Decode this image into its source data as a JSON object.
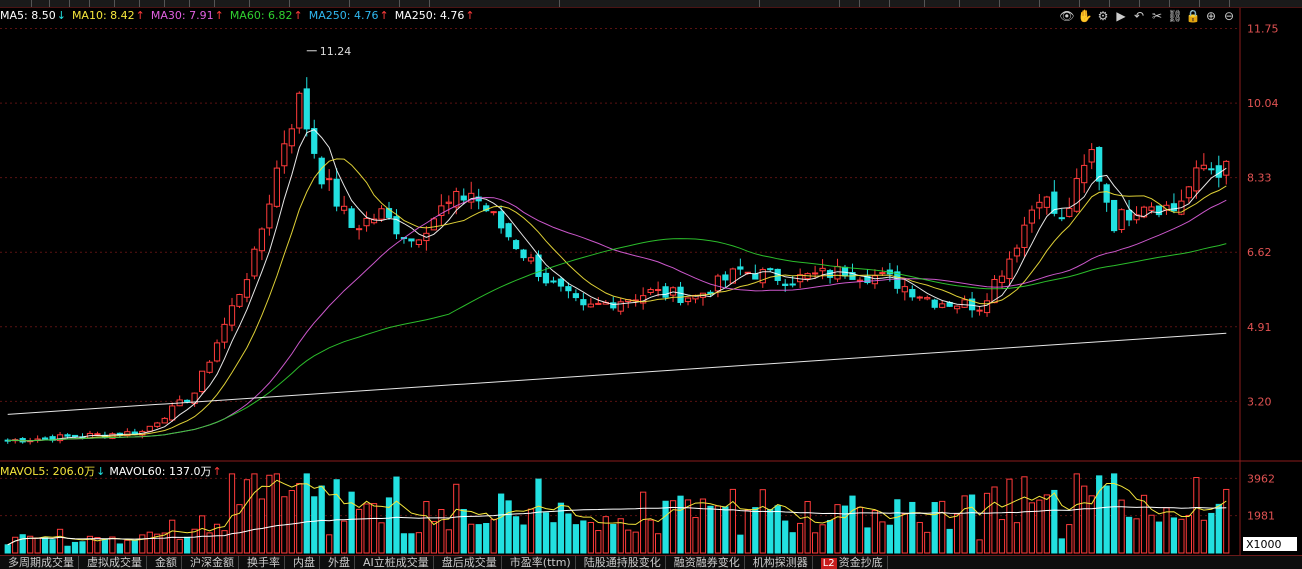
{
  "ma_legend": [
    {
      "label": "MA5: 8.50",
      "trend": "down",
      "color": "#ffffff"
    },
    {
      "label": "MA10: 8.42",
      "trend": "up",
      "color": "#f5e63c"
    },
    {
      "label": "MA30: 7.91",
      "trend": "up",
      "color": "#e060e0"
    },
    {
      "label": "MA60: 6.82",
      "trend": "up",
      "color": "#30d030"
    },
    {
      "label": "MA250: 4.76",
      "trend": "up",
      "color": "#30b8f0"
    },
    {
      "label": "MA250: 4.76",
      "trend": "up",
      "color": "#ffffff"
    }
  ],
  "vol_legend": [
    {
      "label": "MAVOL5: 206.0万",
      "trend": "down",
      "color": "#f5e63c"
    },
    {
      "label": "MAVOL60: 137.0万",
      "trend": "up",
      "color": "#ffffff"
    }
  ],
  "toolbar_icons": [
    "eye-icon",
    "hand-icon",
    "settings-icon",
    "play-icon",
    "undo-icon",
    "scissors-icon",
    "link-icon",
    "lock-icon",
    "zoom-in-icon",
    "zoom-out-icon"
  ],
  "toolbar_glyphs": [
    "👁",
    "✋",
    "⚙",
    "▶",
    "↶",
    "✂",
    "⛓",
    "🔒",
    "⊕",
    "⊖"
  ],
  "price_axis": {
    "ticks": [
      "11.75",
      "10.04",
      "8.33",
      "6.62",
      "4.91",
      "3.20"
    ],
    "high_marker": "11.24"
  },
  "volume_axis": {
    "ticks": [
      "3962",
      "1981"
    ],
    "unit": "X1000"
  },
  "tabs": [
    {
      "label": "多周期成交量"
    },
    {
      "label": "虚拟成交量"
    },
    {
      "label": "金额"
    },
    {
      "label": "沪深金额"
    },
    {
      "label": "换手率"
    },
    {
      "label": "内盘"
    },
    {
      "label": "外盘"
    },
    {
      "label": "AI立桩成交量"
    },
    {
      "label": "盘后成交量"
    },
    {
      "label": "市盈率(ttm)"
    },
    {
      "label": "陆股通持股变化"
    },
    {
      "label": "融资融券变化"
    },
    {
      "label": "机构探测器"
    },
    {
      "label": "资金抄底",
      "badge": "L2"
    }
  ],
  "colors": {
    "up": "#ff3b3b",
    "down": "#22e0e0",
    "grid": "#5a1212",
    "axis_text": "#e05252"
  },
  "chart_data": {
    "type": "candlestick",
    "price_range": [
      1.9,
      11.9
    ],
    "volume_range": [
      0,
      4300
    ],
    "ticks": [
      11.75,
      10.04,
      8.33,
      6.62,
      4.91,
      3.2
    ],
    "volume_ticks": [
      3962,
      1981
    ],
    "series_names": [
      "MA5",
      "MA10",
      "MA30",
      "MA60",
      "MA250"
    ],
    "key_points": [
      {
        "i": 0,
        "p": 2.3
      },
      {
        "i": 18,
        "p": 2.5
      },
      {
        "i": 25,
        "p": 3.4
      },
      {
        "i": 33,
        "p": 6.5
      },
      {
        "i": 37,
        "p": 9.2
      },
      {
        "i": 39,
        "p": 10.1
      },
      {
        "i": 42,
        "p": 8.4
      },
      {
        "i": 46,
        "p": 7.2
      },
      {
        "i": 50,
        "p": 7.5
      },
      {
        "i": 54,
        "p": 6.9
      },
      {
        "i": 58,
        "p": 7.6
      },
      {
        "i": 62,
        "p": 8.0
      },
      {
        "i": 67,
        "p": 7.0
      },
      {
        "i": 72,
        "p": 6.0
      },
      {
        "i": 77,
        "p": 5.3
      },
      {
        "i": 81,
        "p": 5.5
      },
      {
        "i": 86,
        "p": 5.7
      },
      {
        "i": 92,
        "p": 5.6
      },
      {
        "i": 98,
        "p": 6.2
      },
      {
        "i": 105,
        "p": 6.0
      },
      {
        "i": 112,
        "p": 6.2
      },
      {
        "i": 118,
        "p": 6.0
      },
      {
        "i": 124,
        "p": 5.5
      },
      {
        "i": 130,
        "p": 5.4
      },
      {
        "i": 134,
        "p": 6.5
      },
      {
        "i": 138,
        "p": 8.0
      },
      {
        "i": 141,
        "p": 7.3
      },
      {
        "i": 145,
        "p": 8.9
      },
      {
        "i": 148,
        "p": 7.3
      },
      {
        "i": 152,
        "p": 7.8
      },
      {
        "i": 156,
        "p": 7.6
      },
      {
        "i": 160,
        "p": 8.6
      },
      {
        "i": 163,
        "p": 8.5
      }
    ]
  }
}
